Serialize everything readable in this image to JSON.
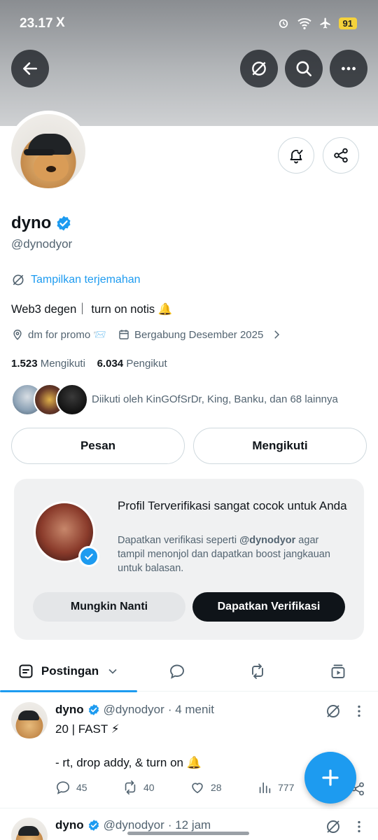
{
  "status_bar": {
    "time": "23.17",
    "app_icon": "X",
    "battery": "91"
  },
  "header": {
    "back_icon": "arrow-left-icon",
    "actions": [
      "translate-off-icon",
      "search-icon",
      "more-icon"
    ]
  },
  "profile": {
    "name": "dyno",
    "handle": "@dynodyor",
    "translate_label": "Tampilkan terjemahan",
    "bio": "Web3 degen｜ turn on notis 🔔",
    "location": "dm for promo 📨",
    "joined": "Bergabung Desember 2025",
    "following_count": "1.523",
    "following_label": "Mengikuti",
    "followers_count": "6.034",
    "followers_label": "Pengikut",
    "followed_by": "Diikuti oleh KinGOfSrDr, King, Banku, dan 68 lainnya",
    "message_button": "Pesan",
    "following_button": "Mengikuti"
  },
  "verify_card": {
    "title": "Profil Terverifikasi sangat cocok untuk Anda",
    "desc_prefix": "Dapatkan verifikasi seperti ",
    "desc_handle": "@dynodyor",
    "desc_suffix": " agar tampil menonjol dan dapatkan boost jangkauan untuk balasan.",
    "later_button": "Mungkin Nanti",
    "verify_button": "Dapatkan Verifikasi"
  },
  "tabs": {
    "active_label": "Postingan",
    "icons": [
      "replies-icon",
      "reposts-icon",
      "media-icon"
    ]
  },
  "tweets": [
    {
      "name": "dyno",
      "handle": "@dynodyor",
      "time": "· 4 menit",
      "line1": "20 | FAST ⚡",
      "line2": "- rt, drop addy, & turn on 🔔",
      "replies": "45",
      "reposts": "40",
      "likes": "28",
      "views": "777"
    },
    {
      "name": "dyno",
      "handle": "@dynodyor",
      "time": "· 12 jam"
    }
  ],
  "colors": {
    "accent": "#1d9bf0",
    "text": "#0f1419",
    "muted": "#536471"
  }
}
